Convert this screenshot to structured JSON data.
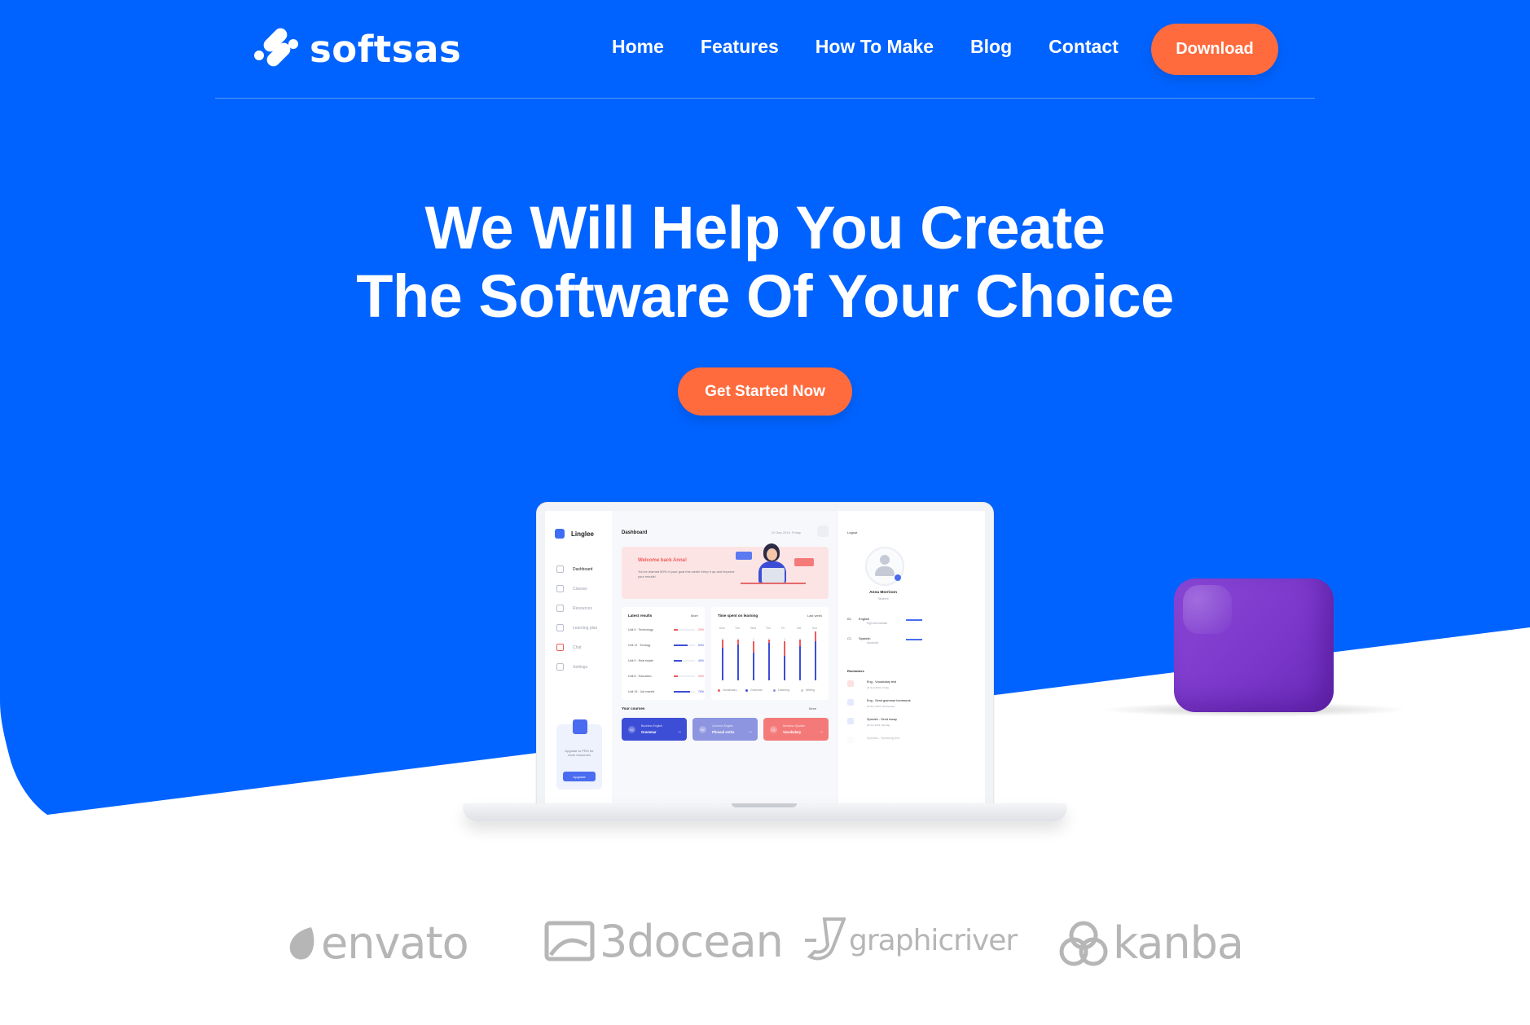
{
  "brand": {
    "name": "softsas",
    "icon": "softsas-logo-icon"
  },
  "nav": {
    "items": [
      "Home",
      "Features",
      "How To Make",
      "Blog",
      "Contact"
    ],
    "download_label": "Download"
  },
  "hero": {
    "title_line1": "We Will Help You Create",
    "title_line2": "The Software Of Your Choice",
    "cta_label": "Get Started Now"
  },
  "dashboard": {
    "app_name": "Linglee",
    "sidebar": [
      "Dashboard",
      "Classes",
      "Resources",
      "Learning plan",
      "Chat",
      "Settings"
    ],
    "upgrade_text": "Upgrade to PRO for more resources",
    "upgrade_button": "Upgrade",
    "title": "Dashboard",
    "date": "20 Sep 2019, Friday",
    "welcome_title": "Welcome back Anna!",
    "welcome_text": "You've learned 80% of your goal this week! Keep it up and improve your results!",
    "latest_results_title": "Latest results",
    "more_label": "More",
    "results": [
      {
        "unit": "Unit 5",
        "topic": "Technology",
        "pct": "20%",
        "fill": 0.2,
        "color": "#f05a5a"
      },
      {
        "unit": "Unit 12",
        "topic": "Ecology",
        "pct": "64%",
        "fill": 0.64,
        "color": "#3d4ed6"
      },
      {
        "unit": "Unit 9",
        "topic": "Real estate",
        "pct": "40%",
        "fill": 0.4,
        "color": "#3d4ed6"
      },
      {
        "unit": "Unit 8",
        "topic": "Education",
        "pct": "20%",
        "fill": 0.2,
        "color": "#f05a5a"
      },
      {
        "unit": "Unit 15",
        "topic": "Job market",
        "pct": "76%",
        "fill": 0.76,
        "color": "#3d4ed6"
      }
    ],
    "time_spent_title": "Time spent on learning",
    "time_range": "Last week",
    "days": [
      "Mon",
      "Tue",
      "Wed",
      "Thu",
      "Fri",
      "Sat",
      "Sun"
    ],
    "legend": [
      "Vocabulary",
      "Grammar",
      "Listening",
      "Writing"
    ],
    "courses_title": "Your courses",
    "courses": [
      {
        "level": "B2",
        "category": "Business English",
        "name": "Grammar",
        "color": "#3d4ed6"
      },
      {
        "level": "B2",
        "category": "Common English",
        "name": "Phrasal verbs",
        "color": "#8d95e0"
      },
      {
        "level": "C1",
        "category": "Business Spanish",
        "name": "Vocabulary",
        "color": "#f47a7a"
      }
    ],
    "logout_label": "Logout",
    "user_name": "Anna Morrison",
    "user_role": "Student",
    "languages": [
      {
        "level": "B2",
        "name": "English",
        "sub": "High Intermediate"
      },
      {
        "level": "C1",
        "name": "Spanish",
        "sub": "Advanced"
      }
    ],
    "reminders_title": "Reminders",
    "reminders": [
      {
        "title": "Eng - Vocabulary test",
        "date": "24 Sep 2019, Friday",
        "color": "#fde0e0"
      },
      {
        "title": "Eng - Send grammar homework",
        "date": "26 Sep 2019, Wednesday",
        "color": "#e4e9fd"
      },
      {
        "title": "Spanish - Send essay",
        "date": "28 Oct 2019, Monday",
        "color": "#e4e9fd"
      },
      {
        "title": "Spanish - Speaking test",
        "date": "",
        "color": "#f3f4f7"
      }
    ]
  },
  "partners": [
    "envato",
    "3docean",
    "graphicriver",
    "kanba"
  ],
  "colors": {
    "hero_blue": "#0063ff",
    "accent_orange": "#ff6b3d",
    "cube_purple": "#7f3dcf",
    "partner_gray": "#b6b6b6"
  }
}
